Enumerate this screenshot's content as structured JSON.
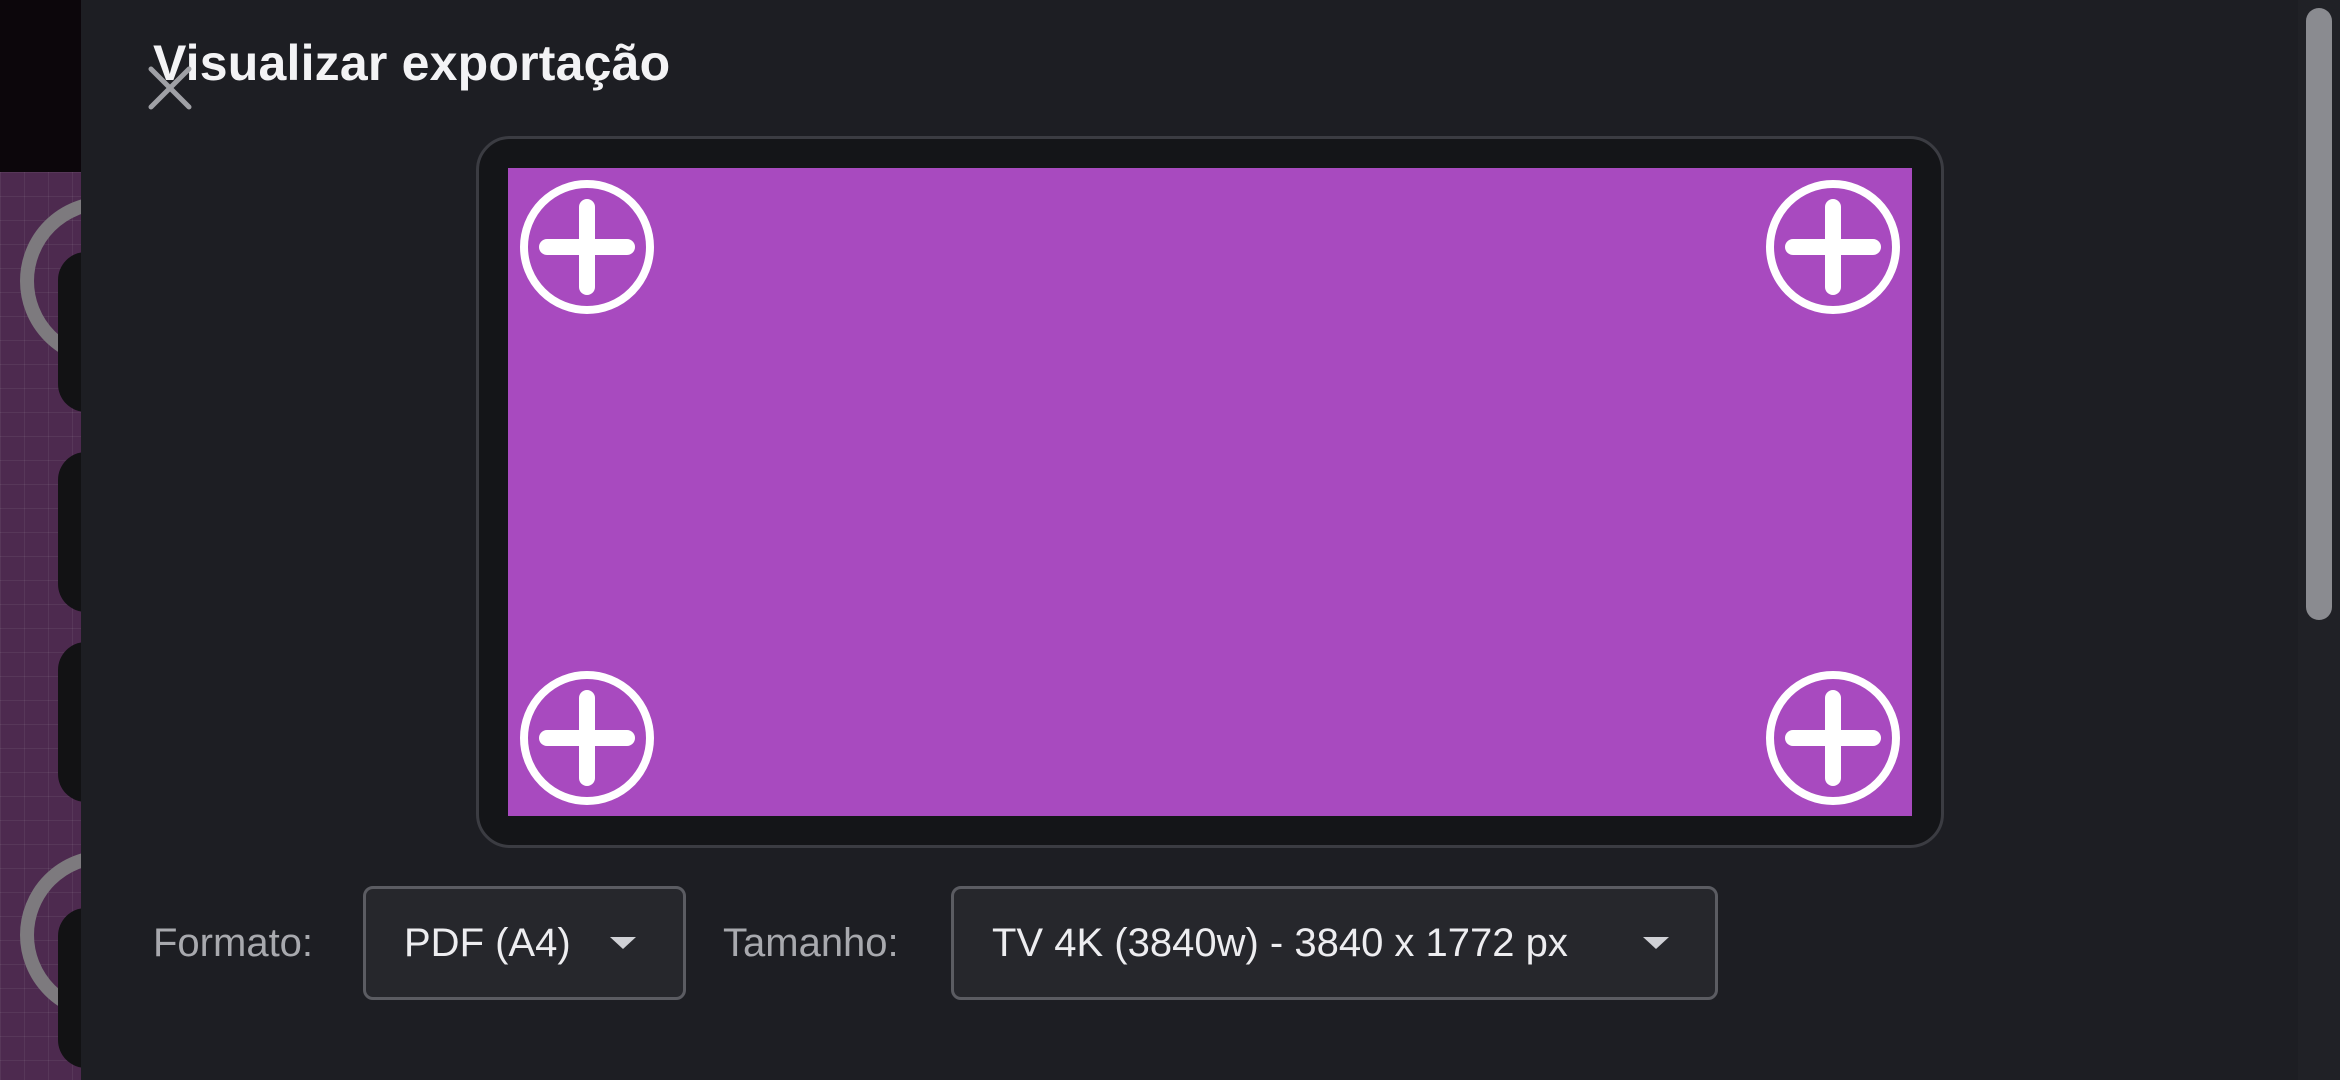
{
  "dialog": {
    "title": "Visualizar exportação"
  },
  "preview": {
    "background_color": "#a84abf",
    "add_buttons": [
      "top-left",
      "top-right",
      "bottom-left",
      "bottom-right"
    ]
  },
  "format": {
    "label": "Formato:",
    "value": "PDF (A4)"
  },
  "size": {
    "label": "Tamanho:",
    "value": "TV 4K (3840w) - 3840 x 1772 px"
  },
  "icons": {
    "close": "close-icon",
    "add": "add-circle-icon",
    "dropdown": "chevron-down-icon"
  },
  "colors": {
    "dialog_background": "#1d1e23",
    "preview_fill": "#a84abf",
    "text": "#f3f3f5",
    "label_text": "#a8a9ae"
  }
}
